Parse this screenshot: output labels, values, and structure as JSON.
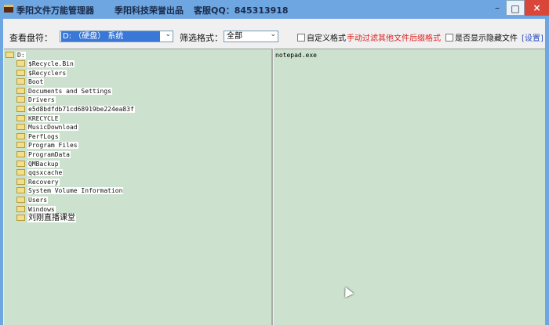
{
  "titlebar": {
    "app": "季阳文件万能管理器",
    "vendor": "季阳科技荣誉出品",
    "qq": "客服QQ：845313918",
    "min": "–",
    "max": "□",
    "close": "×"
  },
  "toolbar": {
    "drive_label": "查看盘符：",
    "drive_value": "D: （硬盘） 系统",
    "filter_label": "筛选格式：",
    "filter_value": "全部",
    "custom_format": "自定义格式",
    "manual_filter": "手动过滤其他文件后缀格式",
    "show_hidden": "是否显示隐藏文件",
    "settings": "[设置]",
    "accent": "#e02020"
  },
  "tree": {
    "root": "D:",
    "folders": [
      "$Recycle.Bin",
      "$Recyclers",
      "Boot",
      "Documents and Settings",
      "Drivers",
      "e5d8bdfdb71cd68919be224ea83f",
      "KRECYCLE",
      "MusicDownload",
      "PerfLogs",
      "Program Files",
      "ProgramData",
      "QMBackup",
      "qqsxcache",
      "Recovery",
      "System Volume Information",
      "Users",
      "Windows",
      "刘刚直播课堂"
    ]
  },
  "files": [
    "notepad.exe"
  ]
}
